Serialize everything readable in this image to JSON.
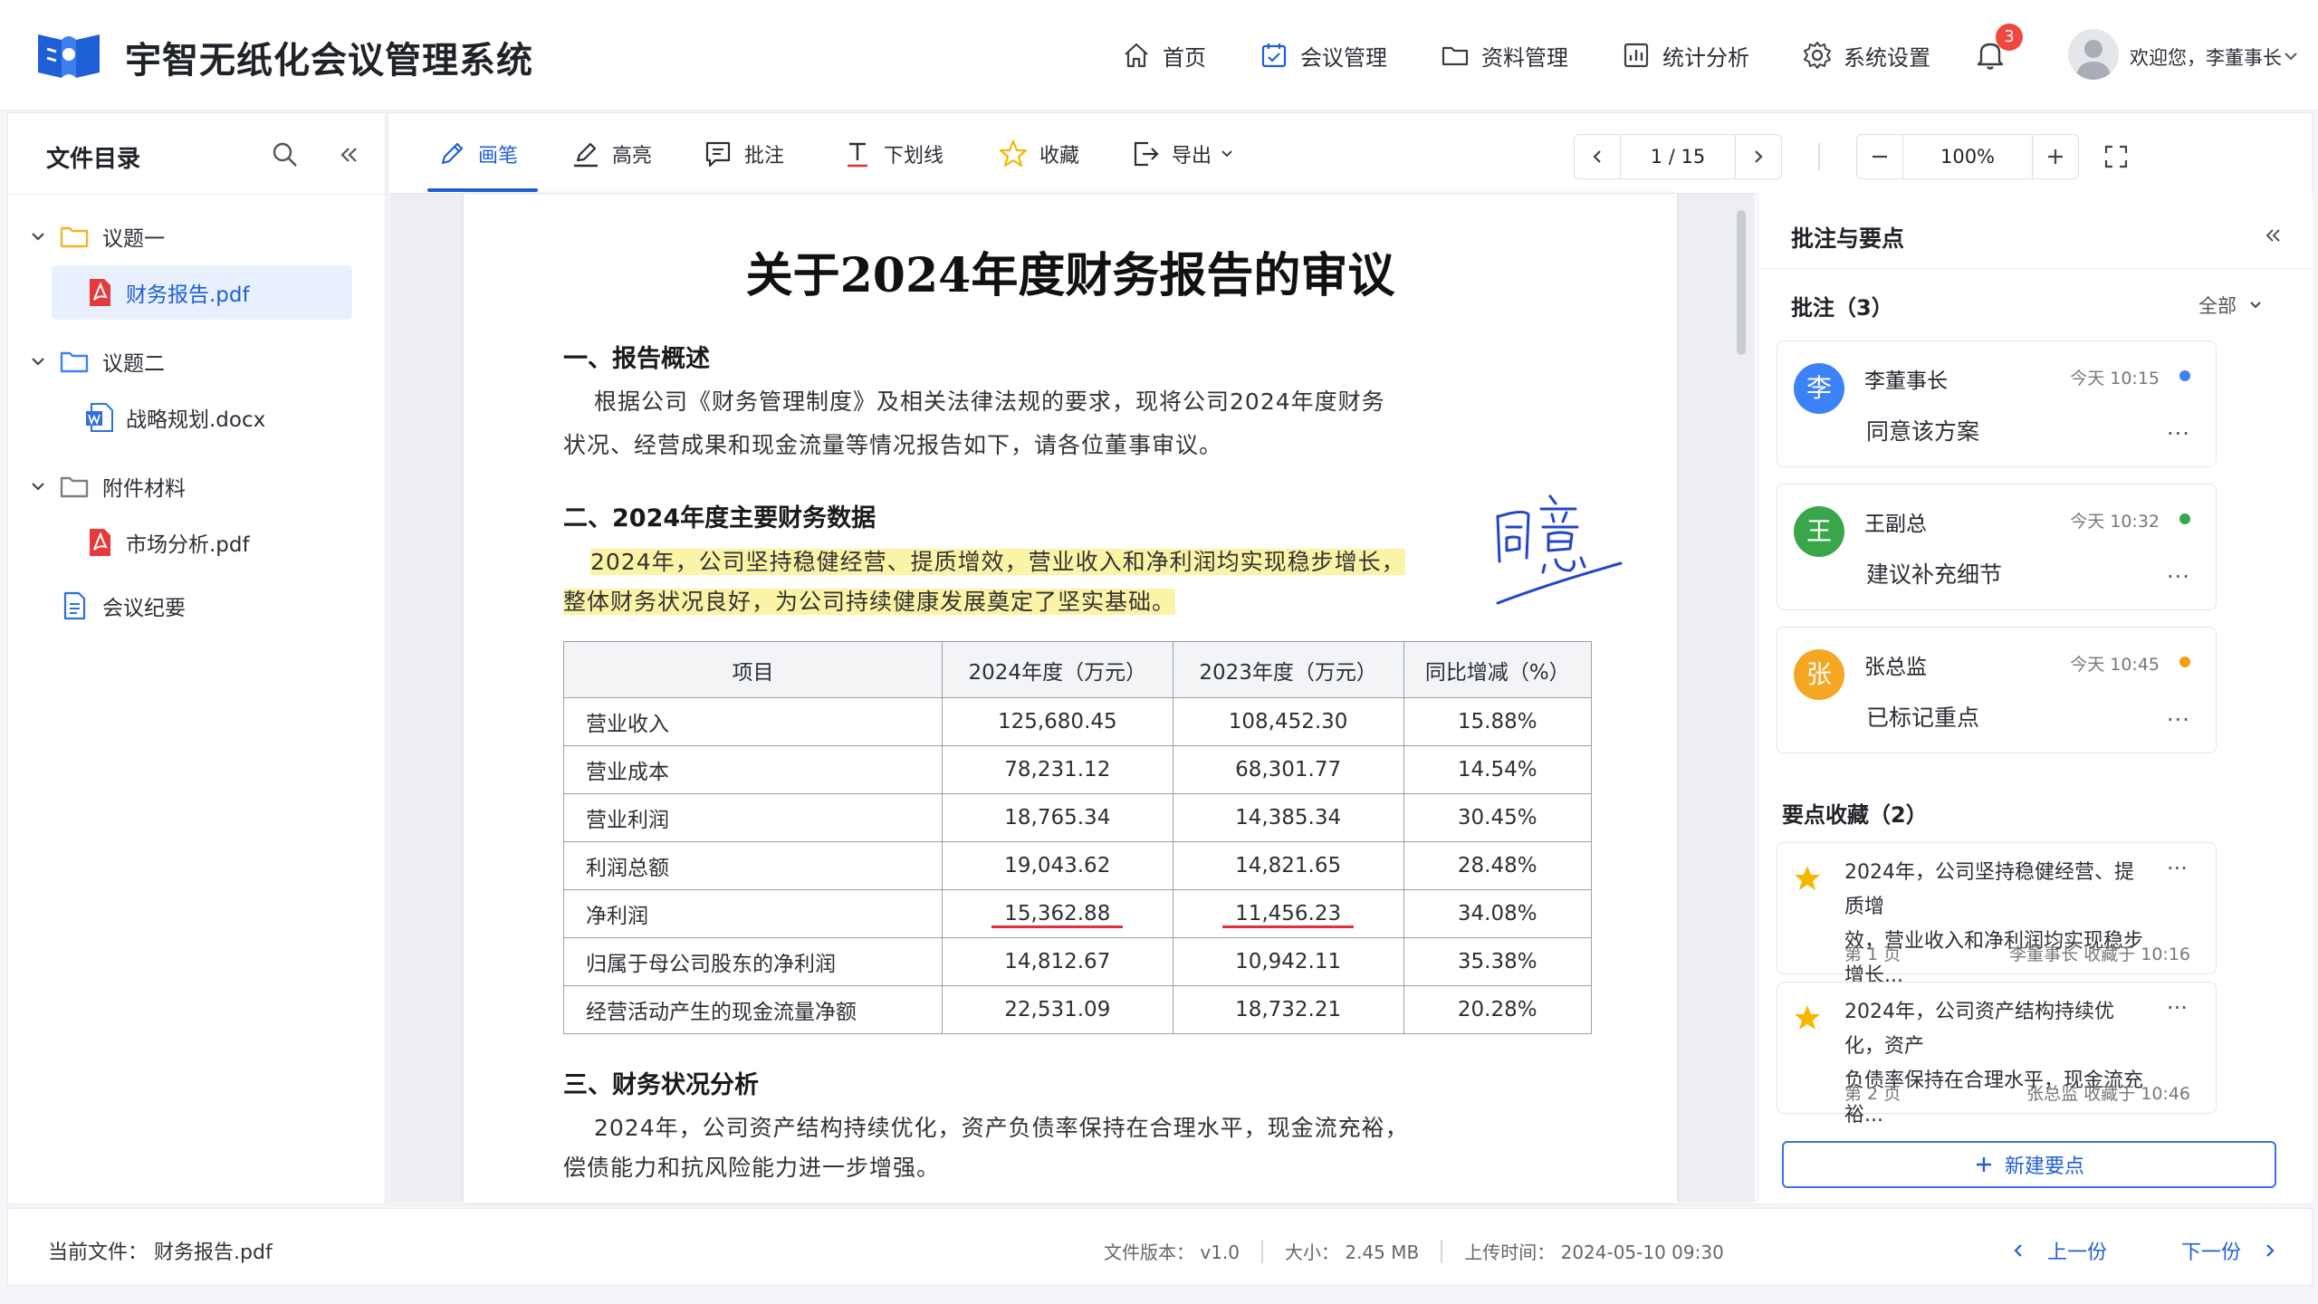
{
  "header": {
    "app_title": "宇智无纸化会议管理系统",
    "nav": [
      {
        "label": "首页",
        "icon": "home-icon"
      },
      {
        "label": "会议管理",
        "icon": "calendar-check-icon"
      },
      {
        "label": "资料管理",
        "icon": "folder-icon"
      },
      {
        "label": "统计分析",
        "icon": "bar-chart-icon"
      },
      {
        "label": "系统设置",
        "icon": "gear-icon"
      }
    ],
    "notification_count": "3",
    "welcome": "欢迎您，李董事长",
    "brand_color": "#1f5fd6"
  },
  "sidebar": {
    "title": "文件目录",
    "tree": [
      {
        "label": "议题一",
        "type": "folder",
        "expanded": true
      },
      {
        "label": "财务报告.pdf",
        "type": "pdf",
        "selected": true
      },
      {
        "label": "议题二",
        "type": "folder",
        "expanded": true
      },
      {
        "label": "战略规划.docx",
        "type": "docx"
      },
      {
        "label": "附件材料",
        "type": "folder",
        "expanded": true
      },
      {
        "label": "市场分析.pdf",
        "type": "pdf"
      },
      {
        "label": "会议纪要",
        "type": "doc"
      }
    ]
  },
  "toolbar": {
    "tools": [
      {
        "label": "画笔",
        "icon": "pen-icon",
        "active": true
      },
      {
        "label": "高亮",
        "icon": "highlighter-icon"
      },
      {
        "label": "批注",
        "icon": "comment-icon"
      },
      {
        "label": "下划线",
        "icon": "underline-icon"
      },
      {
        "label": "收藏",
        "icon": "star-icon"
      },
      {
        "label": "导出",
        "icon": "export-icon"
      }
    ],
    "page_current": "1",
    "page_total": "/ 15",
    "zoom": "100%"
  },
  "document": {
    "title": "关于2024年度财务报告的审议",
    "section1_heading": "一、报告概述",
    "section1_line1": "根据公司《财务管理制度》及相关法律法规的要求，现将公司2024年度财务",
    "section1_line2": "状况、经营成果和现金流量等情况报告如下，请各位董事审议。",
    "section2_heading": "二、2024年度主要财务数据",
    "section2_hl_line1": "2024年，公司坚持稳健经营、提质增效，营业收入和净利润均实现稳步增长，",
    "section2_hl_line2": "整体财务状况良好，为公司持续健康发展奠定了坚实基础。",
    "handwritten_note": "同意",
    "table": {
      "headers": [
        "项目",
        "2024年度（万元）",
        "2023年度（万元）",
        "同比增减（%）"
      ],
      "rows": [
        [
          "营业收入",
          "125,680.45",
          "108,452.30",
          "15.88%"
        ],
        [
          "营业成本",
          "78,231.12",
          "68,301.77",
          "14.54%"
        ],
        [
          "营业利润",
          "18,765.34",
          "14,385.34",
          "30.45%"
        ],
        [
          "利润总额",
          "19,043.62",
          "14,821.65",
          "28.48%"
        ],
        [
          "净利润",
          "15,362.88",
          "11,456.23",
          "34.08%"
        ],
        [
          "归属于母公司股东的净利润",
          "14,812.67",
          "10,942.11",
          "35.38%"
        ],
        [
          "经营活动产生的现金流量净额",
          "22,531.09",
          "18,732.21",
          "20.28%"
        ]
      ]
    },
    "section3_heading": "三、财务状况分析",
    "section3_line1": "2024年，公司资产结构持续优化，资产负债率保持在合理水平，现金流充裕，",
    "section3_line2": "偿债能力和抗风险能力进一步增强。",
    "highlight_color": "#fbf4a6",
    "underline_color": "#e0303a"
  },
  "annotations": {
    "title": "批注与要点",
    "comments_heading": "批注（3）",
    "filter": "全部",
    "comments": [
      {
        "avatar": "李",
        "name": "李董事长",
        "time": "今天 10:15",
        "text": "同意该方案",
        "color": "#3b82f6",
        "dot": "#3b82f6"
      },
      {
        "avatar": "王",
        "name": "王副总",
        "time": "今天 10:32",
        "text": "建议补充细节",
        "color": "#3aa64a",
        "dot": "#3aa64a"
      },
      {
        "avatar": "张",
        "name": "张总监",
        "time": "今天 10:45",
        "text": "已标记重点",
        "color": "#f5a623",
        "dot": "#f59e0b"
      }
    ],
    "keypoints_heading": "要点收藏（2）",
    "keypoints": [
      {
        "line1": "2024年，公司坚持稳健经营、提质增",
        "line2": "效，营业收入和净利润均实现稳步增长...",
        "page": "第 1 页",
        "meta": "李董事长  收藏于 10:16"
      },
      {
        "line1": "2024年，公司资产结构持续优化，资产",
        "line2": "负债率保持在合理水平，现金流充裕...",
        "page": "第 2 页",
        "meta": "张总监  收藏于 10:46"
      }
    ],
    "new_keypoint": "新建要点"
  },
  "status": {
    "current_file_label": "当前文件：",
    "current_file": "财务报告.pdf",
    "version": "文件版本：  v1.0",
    "size": "大小：  2.45 MB",
    "uploaded": "上传时间：  2024-05-10  09:30",
    "prev": "上一份",
    "next": "下一份"
  }
}
